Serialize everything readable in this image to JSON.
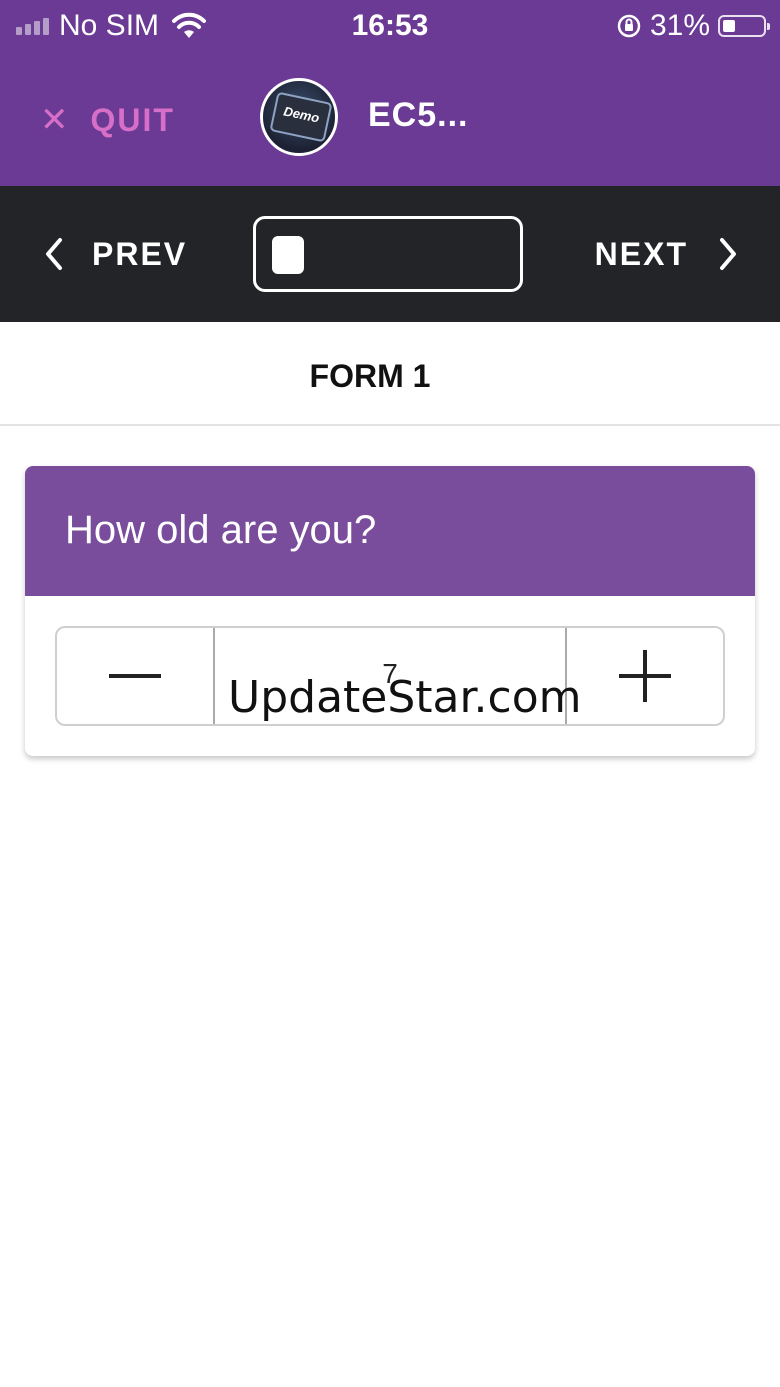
{
  "status_bar": {
    "carrier": "No SIM",
    "time": "16:53",
    "battery_percent": "31%",
    "battery_level": 0.31
  },
  "header": {
    "quit_label": "QUIT",
    "project_logo_text": "Demo",
    "project_title": "EC5..."
  },
  "navigation": {
    "prev_label": "PREV",
    "next_label": "NEXT"
  },
  "form": {
    "title": "FORM 1"
  },
  "question": {
    "text": "How old are you?",
    "value": "7"
  },
  "watermark": "UpdateStar.com",
  "colors": {
    "header_purple": "#6a3a94",
    "card_purple": "#7a4d9c",
    "quit_pink": "#d76fc9",
    "nav_dark": "#222427"
  }
}
